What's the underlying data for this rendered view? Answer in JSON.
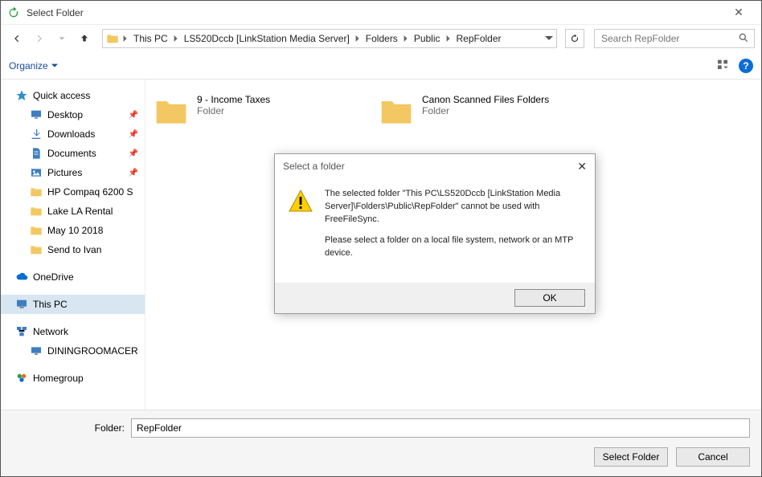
{
  "window_title": "Select Folder",
  "breadcrumbs": [
    "This PC",
    "LS520Dccb [LinkStation Media Server]",
    "Folders",
    "Public",
    "RepFolder"
  ],
  "search_placeholder": "Search RepFolder",
  "toolbar": {
    "organize": "Organize"
  },
  "sidebar": {
    "quick_access": "Quick access",
    "quick_items": [
      {
        "label": "Desktop",
        "pinned": true,
        "icon": "desktop"
      },
      {
        "label": "Downloads",
        "pinned": true,
        "icon": "downloads"
      },
      {
        "label": "Documents",
        "pinned": true,
        "icon": "documents"
      },
      {
        "label": "Pictures",
        "pinned": true,
        "icon": "pictures"
      },
      {
        "label": "HP  Compaq 6200 S",
        "pinned": false,
        "icon": "folder"
      },
      {
        "label": "Lake LA Rental",
        "pinned": false,
        "icon": "folder"
      },
      {
        "label": "May 10 2018",
        "pinned": false,
        "icon": "folder"
      },
      {
        "label": "Send to Ivan",
        "pinned": false,
        "icon": "folder"
      }
    ],
    "onedrive": "OneDrive",
    "this_pc": "This PC",
    "network": "Network",
    "network_items": [
      {
        "label": "DININGROOMACER"
      }
    ],
    "homegroup": "Homegroup"
  },
  "content_items": [
    {
      "name": "9 - Income Taxes",
      "type": "Folder"
    },
    {
      "name": "Canon Scanned Files Folders",
      "type": "Folder"
    }
  ],
  "footer": {
    "label": "Folder:",
    "value": "RepFolder",
    "select": "Select Folder",
    "cancel": "Cancel"
  },
  "modal": {
    "title": "Select a folder",
    "msg1": "The selected folder \"This PC\\LS520Dccb [LinkStation Media Server]\\Folders\\Public\\RepFolder\" cannot be used with FreeFileSync.",
    "msg2": "Please select a folder on a local file system, network or an MTP device.",
    "ok": "OK"
  }
}
